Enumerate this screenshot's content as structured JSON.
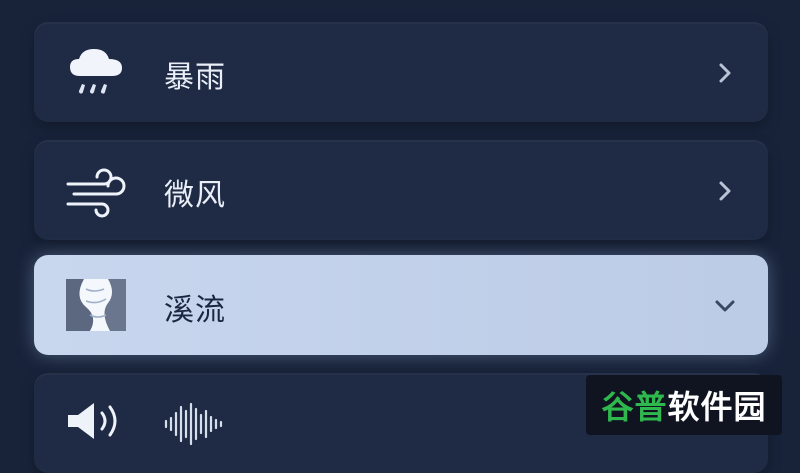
{
  "items": [
    {
      "label": "暴雨",
      "icon": "heavy-rain-icon",
      "state": "collapsed"
    },
    {
      "label": "微风",
      "icon": "breeze-wind-icon",
      "state": "collapsed"
    },
    {
      "label": "溪流",
      "icon": "stream-river-icon",
      "state": "expanded"
    },
    {
      "label": "",
      "icon": "speaker-volume-icon",
      "secondary_icon": "audio-waveform-icon",
      "state": "collapsed"
    }
  ],
  "watermark": {
    "part1": "谷普",
    "part2": "软件园"
  },
  "colors": {
    "background": "#18233a",
    "row": "#1f2b45",
    "selected_row": "#c8d6ee",
    "watermark_green": "#2fb84d"
  }
}
